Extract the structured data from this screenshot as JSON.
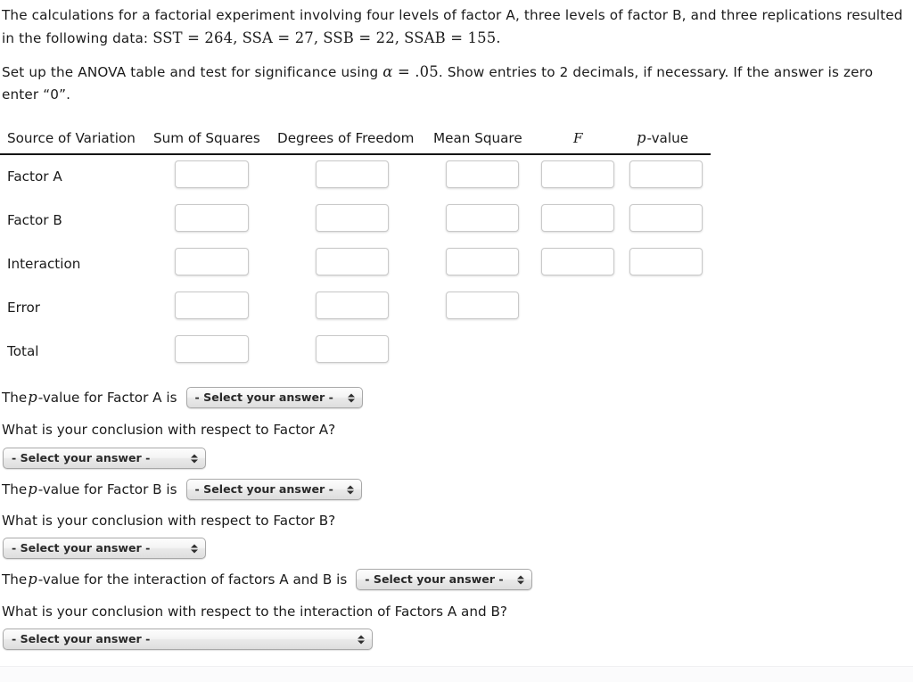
{
  "problem": {
    "paragraph1_part1": "The calculations for a factorial experiment involving four levels of factor A, three levels of factor B, and three replications resulted in the following data: ",
    "math_sst": "SST = 264,",
    "math_ssa": "SSA = 27,",
    "math_ssb": "SSB = 22,",
    "math_ssab": "SSAB = 155.",
    "paragraph2_part1": "Set up the ANOVA table and test for significance using ",
    "alpha_symbol": "α",
    "alpha_eq": " = .05",
    "paragraph2_part2": ". Show entries to 2 decimals, if necessary. If the answer is zero enter “0”."
  },
  "table": {
    "headers": {
      "source": "Source of Variation",
      "sum_of_squares": "Sum of Squares",
      "degrees_of_freedom": "Degrees of Freedom",
      "mean_square": "Mean Square",
      "f": "F",
      "p_value_prefix": "p",
      "p_value_suffix": "-value"
    },
    "rows": [
      {
        "label": "Factor A",
        "inputs": [
          "",
          "",
          "",
          "",
          ""
        ]
      },
      {
        "label": "Factor B",
        "inputs": [
          "",
          "",
          "",
          "",
          ""
        ]
      },
      {
        "label": "Interaction",
        "inputs": [
          "",
          "",
          "",
          "",
          ""
        ]
      },
      {
        "label": "Error",
        "inputs": [
          "",
          "",
          ""
        ]
      },
      {
        "label": "Total",
        "inputs": [
          "",
          ""
        ]
      }
    ]
  },
  "questions": {
    "q1_prefix": "The ",
    "q1_pvar": "p",
    "q1_text": "-value for Factor A is",
    "q2_text": "What is your conclusion with respect to Factor A?",
    "q3_prefix": "The ",
    "q3_pvar": "p",
    "q3_text": "-value for Factor B is",
    "q4_text": "What is your conclusion with respect to Factor B?",
    "q5_prefix": "The ",
    "q5_pvar": "p",
    "q5_text": "-value for the interaction of factors A and B is",
    "q6_text": "What is your conclusion with respect to the interaction of Factors A and B?"
  },
  "select_placeholder": "- Select your answer -",
  "colors": {
    "text": "#1b1b1b",
    "input_border": "#c9c9c9",
    "header_rule": "#141414",
    "select_border": "#a8a8a8",
    "page_background": "#ffffff"
  }
}
